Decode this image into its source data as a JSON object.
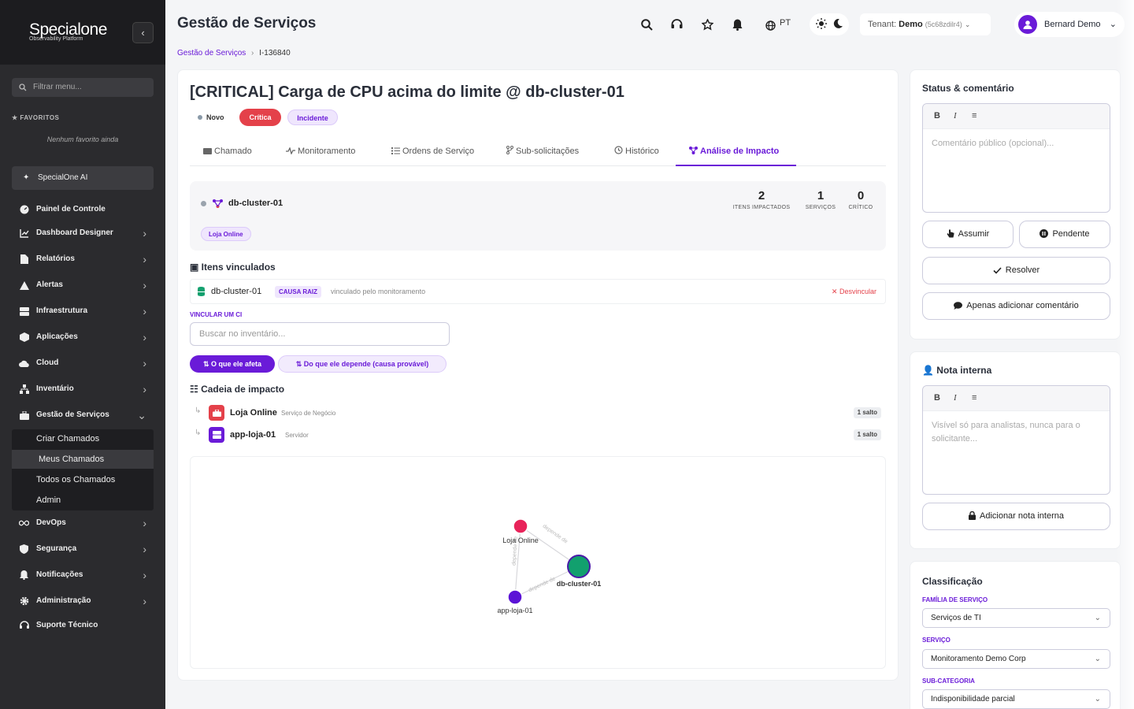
{
  "sidebar": {
    "logo": "Specialone",
    "logo_sub": "Observability Platform",
    "filter_placeholder": "Filtrar menu...",
    "favorites_heading": "FAVORITOS",
    "favorites_empty": "Nenhum favorito ainda",
    "ai_label": "SpecialOne AI",
    "items": [
      {
        "label": "Painel de Controle"
      },
      {
        "label": "Dashboard Designer"
      },
      {
        "label": "Relatórios"
      },
      {
        "label": "Alertas"
      },
      {
        "label": "Infraestrutura"
      },
      {
        "label": "Aplicações"
      },
      {
        "label": "Cloud"
      },
      {
        "label": "Inventário"
      },
      {
        "label": "Gestão de Serviços"
      },
      {
        "label": "DevOps"
      },
      {
        "label": "Segurança"
      },
      {
        "label": "Notificações"
      },
      {
        "label": "Administração"
      },
      {
        "label": "Suporte Técnico"
      }
    ],
    "submenu": [
      {
        "label": "Criar Chamados"
      },
      {
        "label": "Meus Chamados"
      },
      {
        "label": "Todos os Chamados"
      },
      {
        "label": "Admin"
      }
    ]
  },
  "header": {
    "title": "Gestão de Serviços",
    "lang": "PT",
    "tenant_label": "Tenant:",
    "tenant_name": "Demo",
    "tenant_code": "(5c68zdilr4)",
    "user_name": "Bernard Demo"
  },
  "breadcrumb": {
    "parent": "Gestão de Serviços",
    "current": "I-136840"
  },
  "ticket": {
    "title": "[CRITICAL] Carga de CPU acima do limite @ db-cluster-01",
    "status": "Novo",
    "priority": "Crítica",
    "type": "Incidente",
    "tabs": [
      {
        "label": "Chamado"
      },
      {
        "label": "Monitoramento"
      },
      {
        "label": "Ordens de Serviço"
      },
      {
        "label": "Sub-solicitações"
      },
      {
        "label": "Histórico"
      },
      {
        "label": "Análise de Impacto"
      }
    ]
  },
  "impact": {
    "ci_name": "db-cluster-01",
    "ci_tag": "Loja Online",
    "stats": [
      {
        "value": "2",
        "label": "ITENS IMPACTADOS"
      },
      {
        "value": "1",
        "label": "SERVIÇOS"
      },
      {
        "value": "0",
        "label": "CRÍTICO"
      }
    ],
    "linked_heading": "Itens vinculados",
    "linked_item": {
      "name": "db-cluster-01",
      "badge": "CAUSA RAIZ",
      "via": "vinculado pelo monitoramento",
      "unlink": "Desvincular"
    },
    "link_label": "VINCULAR UM CI",
    "search_placeholder": "Buscar no inventário...",
    "btn_affects": "O que ele afeta",
    "btn_depends": "Do que ele depende (causa provável)",
    "chain_heading": "Cadeia de impacto",
    "chain": [
      {
        "name": "Loja Online",
        "type": "Serviço de Negócio",
        "hops": "1 salto",
        "color": "#e4414a"
      },
      {
        "name": "app-loja-01",
        "type": "Servidor",
        "hops": "1 salto",
        "color": "#6a1bd8"
      }
    ],
    "graph": {
      "nodes": [
        {
          "label": "Loja Online",
          "color": "#e8245a"
        },
        {
          "label": "db-cluster-01",
          "color": "#12a06e"
        },
        {
          "label": "app-loja-01",
          "color": "#5b13d6"
        }
      ],
      "edge_label": "depende de"
    }
  },
  "status_panel": {
    "title": "Status & comentário",
    "placeholder": "Comentário público (opcional)...",
    "btn_assume": "Assumir",
    "btn_pending": "Pendente",
    "btn_resolve": "Resolver",
    "btn_comment": "Apenas adicionar comentário"
  },
  "note_panel": {
    "title": "Nota interna",
    "placeholder": "Visível só para analistas, nunca para o solicitante...",
    "btn_add": "Adicionar nota interna"
  },
  "classification": {
    "title": "Classificação",
    "family_label": "FAMÍLIA DE SERVIÇO",
    "family_value": "Serviços de TI",
    "service_label": "SERVIÇO",
    "service_value": "Monitoramento Demo Corp",
    "subcat_label": "SUB-CATEGORIA",
    "subcat_value": "Indisponibilidade parcial"
  },
  "colors": {
    "accent": "#6a1bd8",
    "critical": "#e4414a",
    "sidebar": "#2b2b2e"
  }
}
